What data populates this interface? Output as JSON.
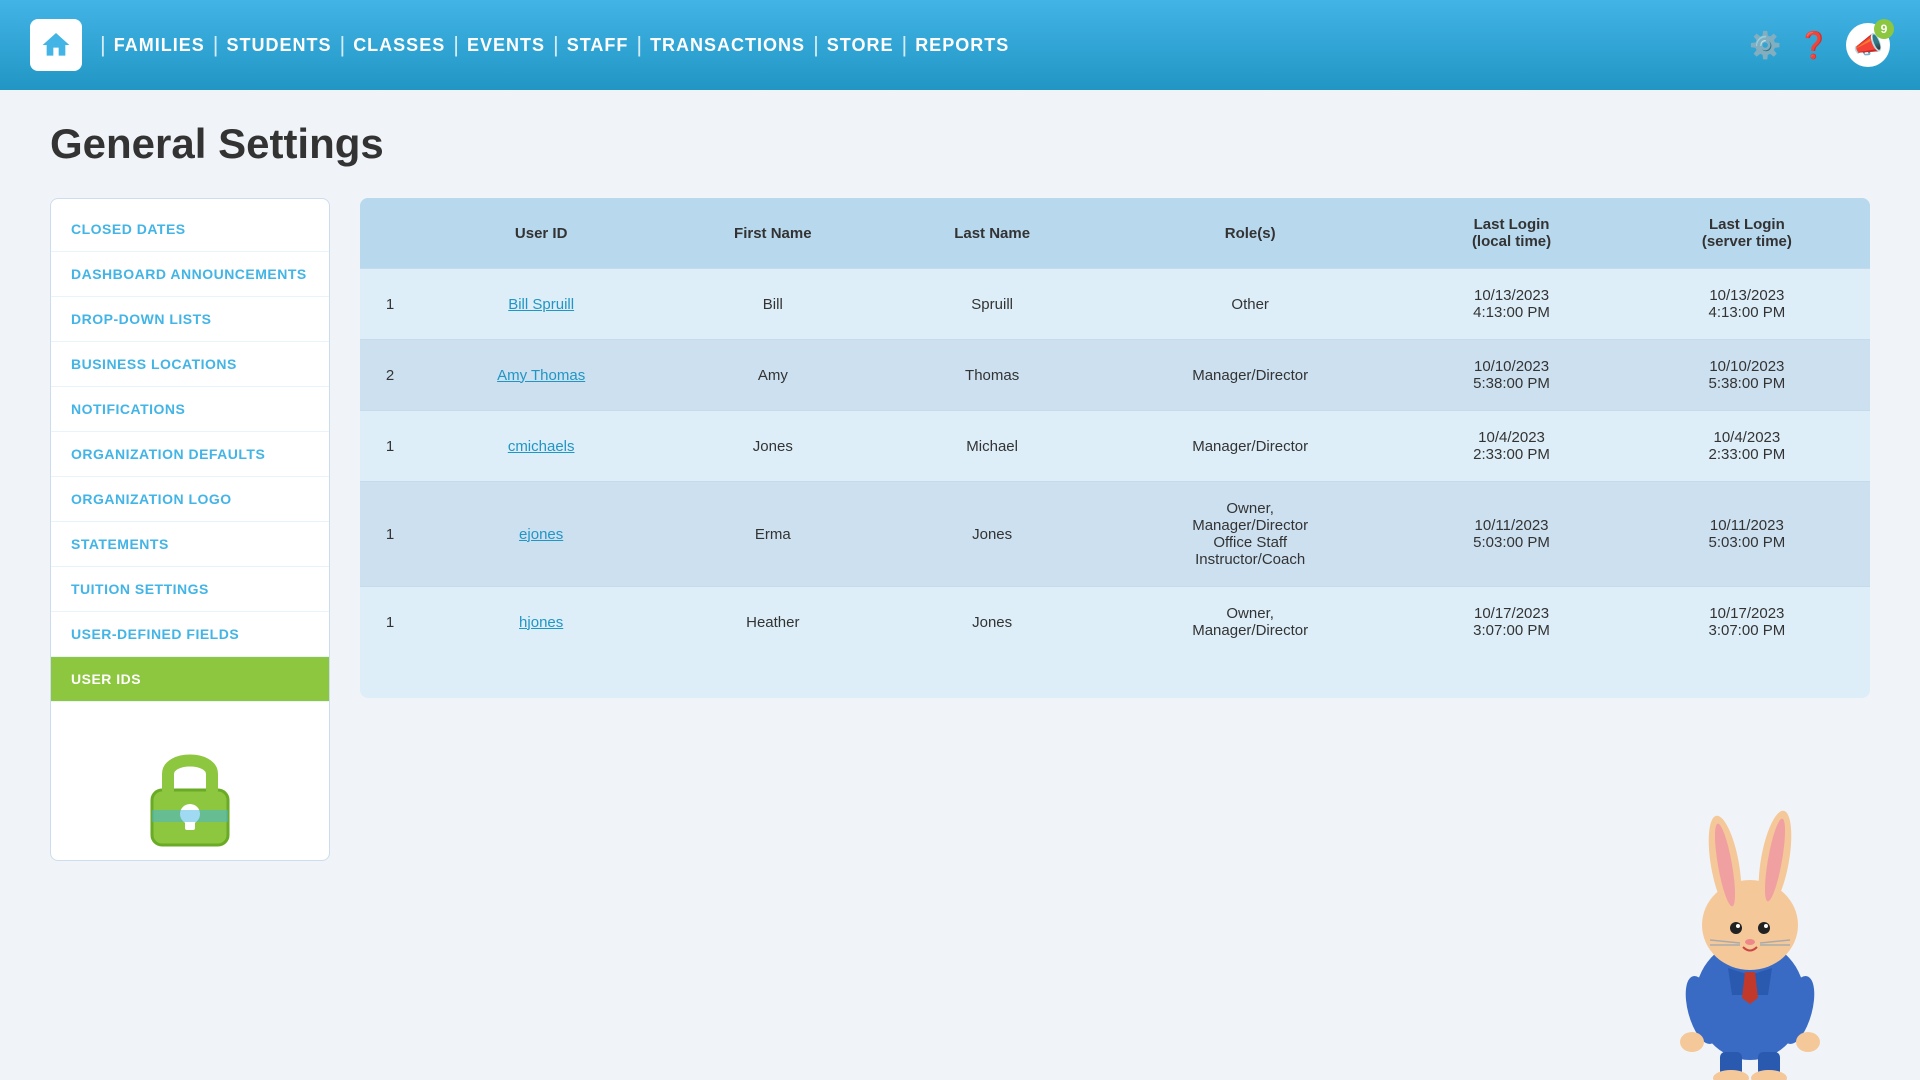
{
  "navbar": {
    "home_label": "🏠",
    "links": [
      "FAMILIES",
      "STUDENTS",
      "CLASSES",
      "EVENTS",
      "STAFF",
      "TRANSACTIONS",
      "STORE",
      "REPORTS"
    ],
    "notification_count": "9"
  },
  "page": {
    "title": "General Settings"
  },
  "sidebar": {
    "items": [
      {
        "label": "CLOSED DATES",
        "active": false
      },
      {
        "label": "DASHBOARD ANNOUNCEMENTS",
        "active": false
      },
      {
        "label": "DROP-DOWN LISTS",
        "active": false
      },
      {
        "label": "BUSINESS LOCATIONS",
        "active": false
      },
      {
        "label": "NOTIFICATIONS",
        "active": false
      },
      {
        "label": "ORGANIZATION DEFAULTS",
        "active": false
      },
      {
        "label": "ORGANIZATION LOGO",
        "active": false
      },
      {
        "label": "STATEMENTS",
        "active": false
      },
      {
        "label": "TUITION SETTINGS",
        "active": false
      },
      {
        "label": "USER-DEFINED FIELDS",
        "active": false
      },
      {
        "label": "USER IDS",
        "active": true
      }
    ]
  },
  "table": {
    "headers": [
      "User ID",
      "First Name",
      "Last Name",
      "Role(s)",
      "Last Login\n(local time)",
      "Last Login\n(server time)"
    ],
    "rows": [
      {
        "num": "1",
        "user_id": "Bill Spruill",
        "first_name": "Bill",
        "last_name": "Spruill",
        "roles": "Other",
        "local_login": "10/13/2023\n4:13:00 PM",
        "server_login": "10/13/2023\n4:13:00 PM"
      },
      {
        "num": "2",
        "user_id": "Amy Thomas",
        "first_name": "Amy",
        "last_name": "Thomas",
        "roles": "Manager/Director",
        "local_login": "10/10/2023\n5:38:00 PM",
        "server_login": "10/10/2023\n5:38:00 PM"
      },
      {
        "num": "1",
        "user_id": "cmichaels",
        "first_name": "Jones",
        "last_name": "Michael",
        "roles": "Manager/Director",
        "local_login": "10/4/2023\n2:33:00 PM",
        "server_login": "10/4/2023\n2:33:00 PM"
      },
      {
        "num": "1",
        "user_id": "ejones",
        "first_name": "Erma",
        "last_name": "Jones",
        "roles": "Owner,\nManager/Director\nOffice Staff\nInstructor/Coach",
        "local_login": "10/11/2023\n5:03:00 PM",
        "server_login": "10/11/2023\n5:03:00 PM"
      },
      {
        "num": "1",
        "user_id": "hjones",
        "first_name": "Heather",
        "last_name": "Jones",
        "roles": "Owner,\nManager/Director",
        "local_login": "10/17/2023\n3:07:00 PM",
        "server_login": "10/17/2023\n3:07:00 PM"
      }
    ]
  }
}
